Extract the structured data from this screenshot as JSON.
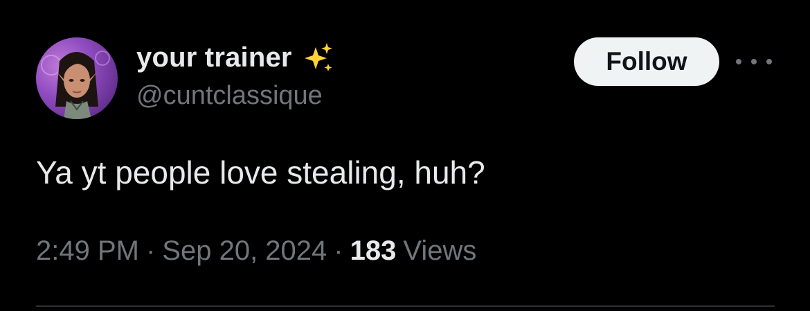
{
  "user": {
    "display_name": "your trainer",
    "handle": "@cuntclassique",
    "badge_icon": "sparkles-icon"
  },
  "actions": {
    "follow_label": "Follow",
    "more_icon": "more-options-icon"
  },
  "tweet": {
    "text": "Ya yt people love stealing, huh?",
    "time": "2:49 PM",
    "separator": "·",
    "date": "Sep 20, 2024",
    "views_count": "183",
    "views_label": "Views"
  },
  "colors": {
    "background": "#000000",
    "primary_text": "#e7e9ea",
    "secondary_text": "#71767b",
    "follow_bg": "#eff3f4",
    "sparkle": "#ffd43b"
  }
}
